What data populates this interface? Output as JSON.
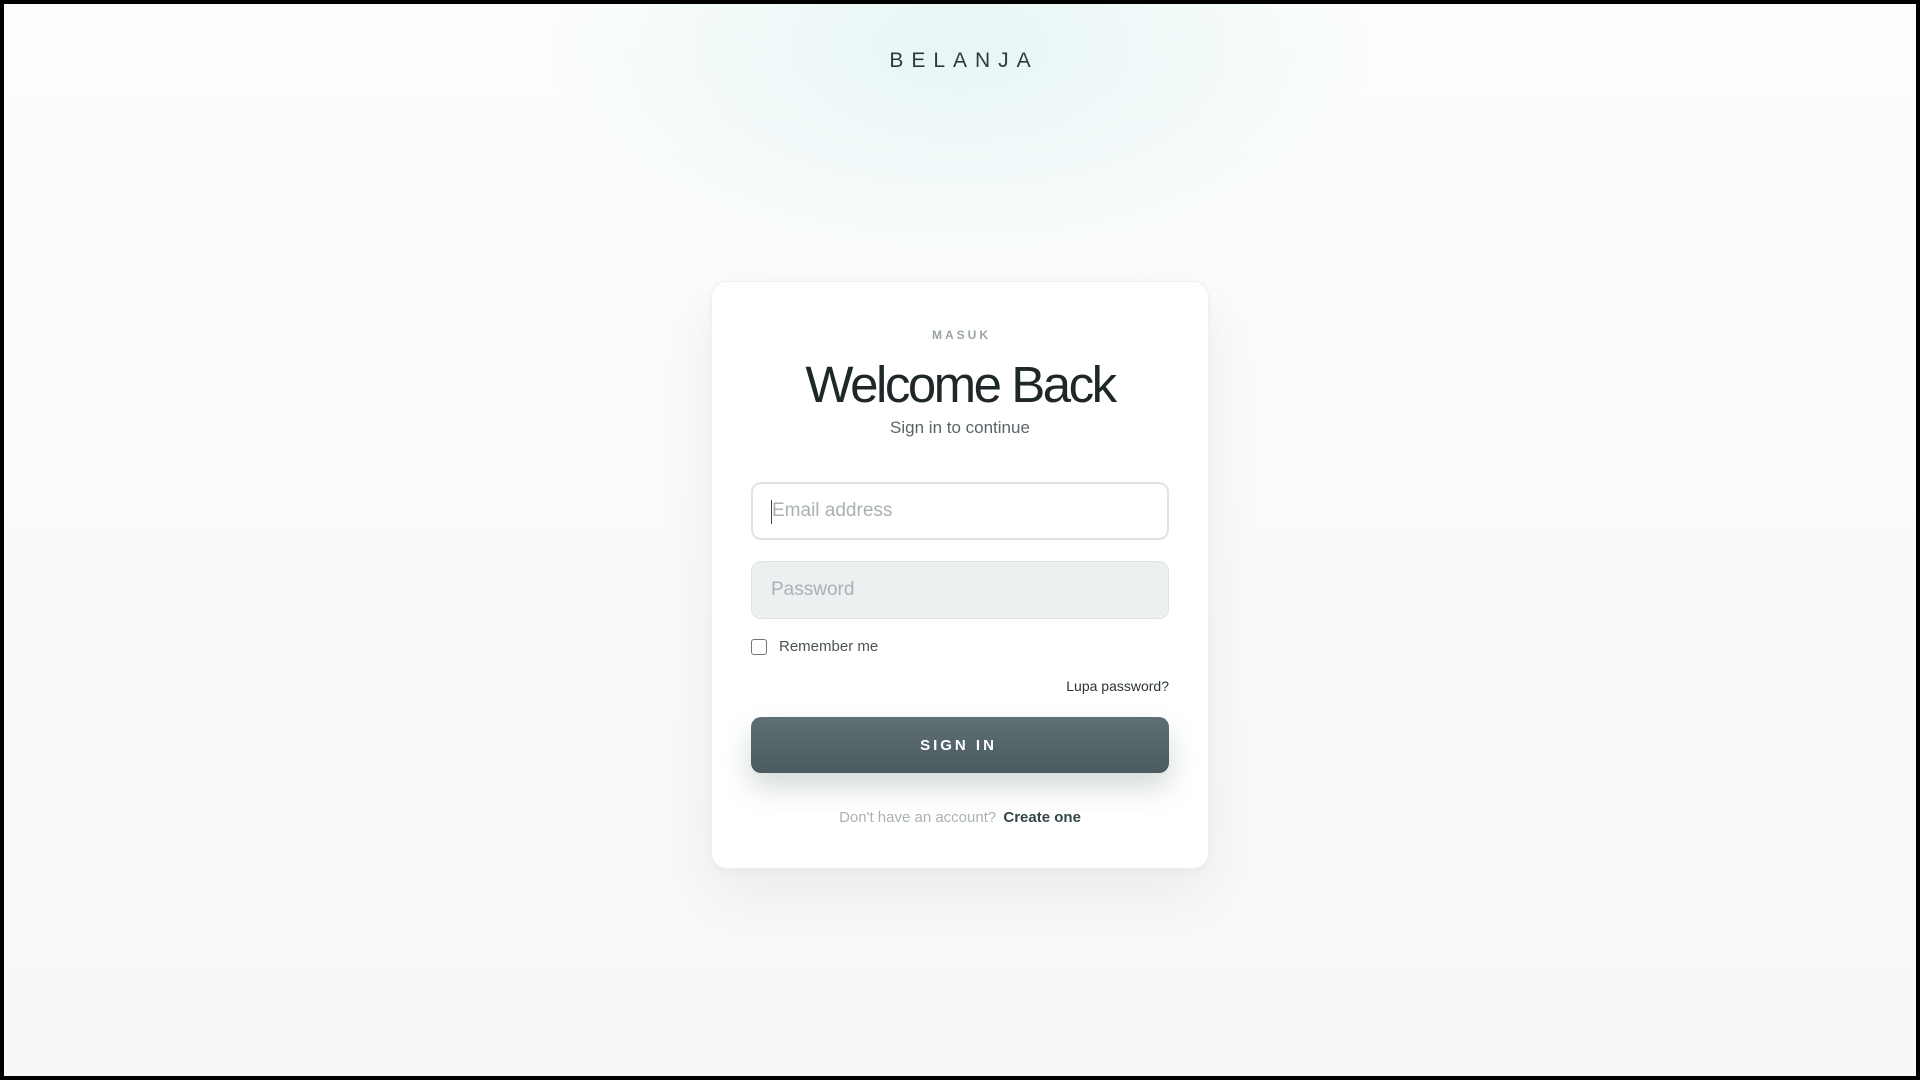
{
  "brand": {
    "name": "BELANJA"
  },
  "card": {
    "eyebrow": "MASUK",
    "title": "Welcome Back",
    "subtitle": "Sign in to continue"
  },
  "form": {
    "email": {
      "placeholder": "Email address",
      "value": ""
    },
    "password": {
      "placeholder": "Password",
      "value": ""
    },
    "remember": {
      "label": "Remember me",
      "checked": false
    },
    "forgot_label": "Lupa password?",
    "submit_label": "SIGN IN"
  },
  "footer": {
    "prompt": "Don't have an account?",
    "link_label": "Create one"
  },
  "colors": {
    "accent": "#52656a",
    "text": "#1f2829",
    "muted": "#9aa3a6"
  }
}
